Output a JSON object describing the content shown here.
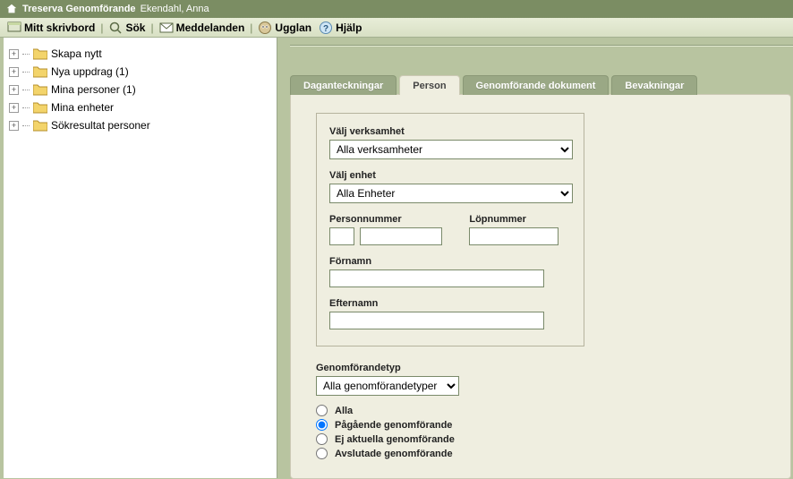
{
  "titlebar": {
    "app_title": "Treserva Genomförande",
    "user_name": "Ekendahl, Anna"
  },
  "menubar": {
    "desktop": "Mitt skrivbord",
    "search": "Sök",
    "messages": "Meddelanden",
    "ugglan": "Ugglan",
    "help": "Hjälp"
  },
  "tree": {
    "items": [
      {
        "label": "Skapa nytt"
      },
      {
        "label": "Nya uppdrag (1)"
      },
      {
        "label": "Mina personer (1)"
      },
      {
        "label": "Mina enheter"
      },
      {
        "label": "Sökresultat personer"
      }
    ]
  },
  "tabs": {
    "daganteckningar": "Daganteckningar",
    "person": "Person",
    "genomforande_dokument": "Genomförande dokument",
    "bevakningar": "Bevakningar"
  },
  "form": {
    "valj_verksamhet_label": "Välj verksamhet",
    "valj_verksamhet_value": "Alla verksamheter",
    "valj_enhet_label": "Välj enhet",
    "valj_enhet_value": "Alla Enheter",
    "personnummer_label": "Personnummer",
    "lopnummer_label": "Löpnummer",
    "fornamn_label": "Förnamn",
    "efternamn_label": "Efternamn",
    "genomforandetyp_label": "Genomförandetyp",
    "genomforandetyp_value": "Alla genomförandetyper",
    "radios": {
      "alla": "Alla",
      "pagaende": "Pågående genomförande",
      "ej_aktuella": "Ej aktuella genomförande",
      "avslutade": "Avslutade genomförande"
    }
  }
}
